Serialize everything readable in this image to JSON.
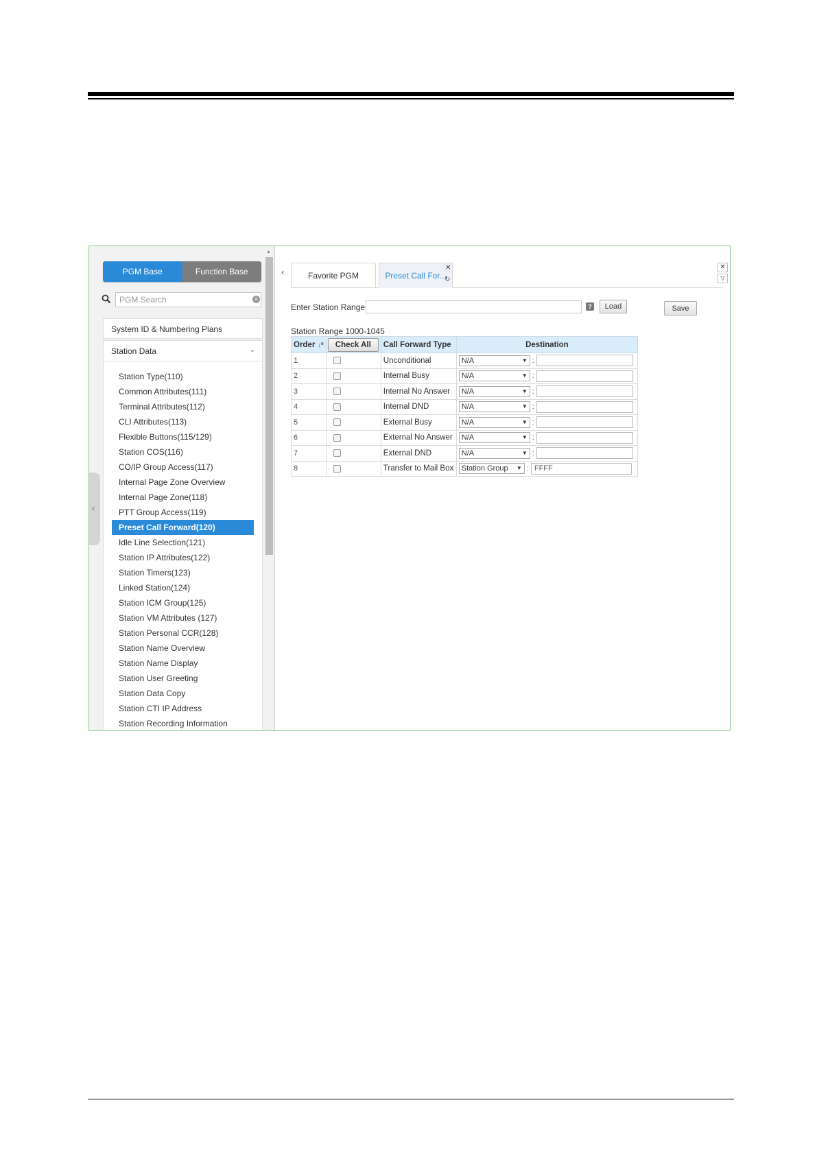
{
  "left_panel": {
    "toggle": {
      "pgm_base": "PGM Base",
      "function_base": "Function Base"
    },
    "search": {
      "placeholder": "PGM Search"
    },
    "system_id_label": "System ID & Numbering Plans",
    "station_data_label": "Station Data",
    "station_items": [
      "Station Type(110)",
      "Common Attributes(111)",
      "Terminal Attributes(112)",
      "CLI Attributes(113)",
      "Flexible Buttons(115/129)",
      "Station COS(116)",
      "CO/IP Group Access(117)",
      "Internal Page Zone Overview",
      "Internal Page Zone(118)",
      "PTT Group Access(119)",
      "Preset Call Forward(120)",
      "Idle Line Selection(121)",
      "Station IP Attributes(122)",
      "Station Timers(123)",
      "Linked Station(124)",
      "Station ICM Group(125)",
      "Station VM Attributes (127)",
      "Station Personal CCR(128)",
      "Station Name Overview",
      "Station Name Display",
      "Station User Greeting",
      "Station Data Copy",
      "Station CTI IP Address",
      "Station Recording Information"
    ],
    "active_item_index": 10
  },
  "tabs": {
    "favorite": "Favorite PGM",
    "preset": "Preset Call For..."
  },
  "form": {
    "range_label": "Enter Station Range :",
    "range_value": "",
    "load_label": "Load",
    "save_label": "Save",
    "station_range_text": "Station Range 1000-1045"
  },
  "table": {
    "headers": {
      "order": "Order",
      "check_all": "Check All",
      "call_forward_type": "Call Forward Type",
      "destination": "Destination"
    },
    "rows": [
      {
        "order": "1",
        "type": "Unconditional",
        "select": "N/A",
        "dest": ""
      },
      {
        "order": "2",
        "type": "Internal Busy",
        "select": "N/A",
        "dest": ""
      },
      {
        "order": "3",
        "type": "Internal No Answer",
        "select": "N/A",
        "dest": ""
      },
      {
        "order": "4",
        "type": "Internal DND",
        "select": "N/A",
        "dest": ""
      },
      {
        "order": "5",
        "type": "External Busy",
        "select": "N/A",
        "dest": ""
      },
      {
        "order": "6",
        "type": "External No Answer",
        "select": "N/A",
        "dest": ""
      },
      {
        "order": "7",
        "type": "External DND",
        "select": "N/A",
        "dest": ""
      },
      {
        "order": "8",
        "type": "Transfer to Mail Box",
        "select": "Station Group",
        "dest": "FFFF"
      }
    ]
  },
  "colors": {
    "accent": "#2b8ad8",
    "header_bg": "#d9ecf9",
    "frame_border": "#8cc68c"
  }
}
